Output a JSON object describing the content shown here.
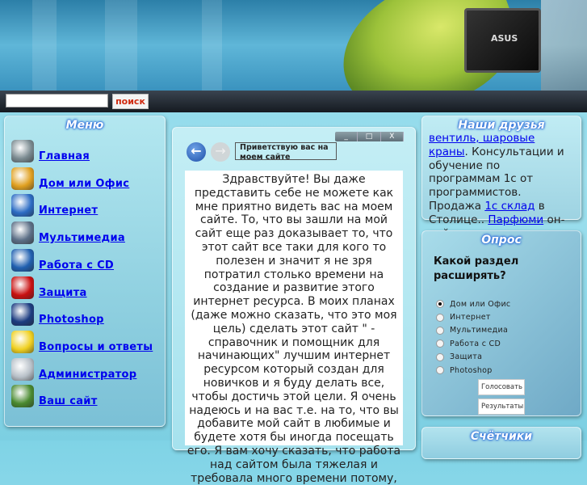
{
  "search": {
    "placeholder": "",
    "button": "поиск"
  },
  "header": {
    "laptop_brand": "ASUS"
  },
  "menu": {
    "title": "Меню",
    "items": [
      {
        "label": "Главная",
        "icon": "computer-icon",
        "color": "#7a8a90"
      },
      {
        "label": "Дом или Офис",
        "icon": "joomla-icon",
        "color": "#e0a020"
      },
      {
        "label": "Интернет",
        "icon": "internet-explorer-icon",
        "color": "#2c6cc4"
      },
      {
        "label": "Мультимедиа",
        "icon": "speaker-icon",
        "color": "#5c6f86"
      },
      {
        "label": "Работа с CD",
        "icon": "cd-icon",
        "color": "#2060b0"
      },
      {
        "label": "Защита",
        "icon": "kaspersky-icon",
        "color": "#c81010"
      },
      {
        "label": "Photoshop",
        "icon": "photoshop-icon",
        "color": "#1c3c80"
      },
      {
        "label": "Вопросы и ответы",
        "icon": "star-icon",
        "color": "#f0d020"
      },
      {
        "label": "Администратор",
        "icon": "mobile-phone-icon",
        "color": "#b8c0c8"
      },
      {
        "label": "Ваш сайт",
        "icon": "gear-icon",
        "color": "#4a8a30"
      }
    ]
  },
  "center": {
    "greeting": "Приветствую вас на моем сайте",
    "window_controls": [
      "_",
      "□",
      "X"
    ],
    "text": "Здравствуйте! Вы даже представить себе не можете как мне приятно видеть вас на моем сайте. То, что вы зашли на мой сайт еще раз доказывает то, что этот сайт все таки для кого то полезен и значит я не зря потратил столько времени на создание и развитие этого интернет ресурса. В моих планах (даже можно сказать, что это моя цель) сделать этот сайт \" - справочник и помощник для начинающих\" лучшим интернет ресурсом который создан для новичков и я буду делать все, чтобы достичь этой цели. Я очень надеюсь и на вас т.е. на то, что вы добавите мой сайт в любимые и будете хотя бы иногда посещать его. Я вам хочу сказать, что работа над сайтом была тяжелая и требовала много времени потому,"
  },
  "friends": {
    "title": "Наши друзья",
    "link1": "вентиль, шаровые краны",
    "text1": ". Консультации и обучение по программам 1с от программистов. Продажа ",
    "link2": "1с склад",
    "text2": " в Столице.. ",
    "link3": "Парфюми",
    "text3": " он-лайн."
  },
  "poll": {
    "title": "Опрос",
    "question": "Какой раздел расширять?",
    "options": [
      "Дом или Офис",
      "Интернет",
      "Мультимедиа",
      "Работа с CD",
      "Защита",
      "Photoshop"
    ],
    "selected": 0,
    "vote": "Голосовать",
    "results": "Результаты"
  },
  "counters": {
    "title": "Счётчики"
  }
}
